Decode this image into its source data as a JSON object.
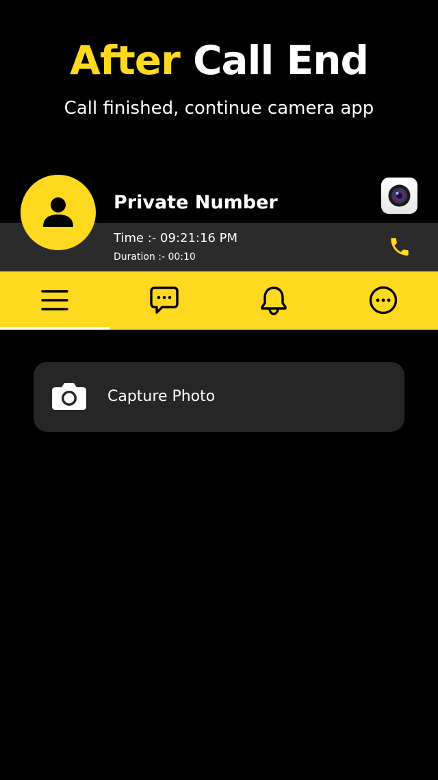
{
  "header": {
    "title_accent": "After",
    "title_rest": "Call End",
    "subtitle": "Call finished, continue camera app"
  },
  "call": {
    "caller_name": "Private Number",
    "time_text": "Time :- 09:21:16 PM",
    "duration_text": "Duration :- 00:10",
    "avatar_icon": "person-icon",
    "app_icon": "camera-lens-icon",
    "call_icon": "phone-icon"
  },
  "tabs": [
    {
      "icon": "menu-icon",
      "selected": true
    },
    {
      "icon": "message-icon",
      "selected": false
    },
    {
      "icon": "bell-icon",
      "selected": false
    },
    {
      "icon": "more-icon",
      "selected": false
    }
  ],
  "actions": [
    {
      "label": "Capture Photo",
      "icon": "camera-icon"
    }
  ],
  "colors": {
    "accent": "#FFD91F",
    "background": "#000000",
    "strip": "#2B2B2B",
    "card": "#262626",
    "text": "#FFFFFF"
  }
}
